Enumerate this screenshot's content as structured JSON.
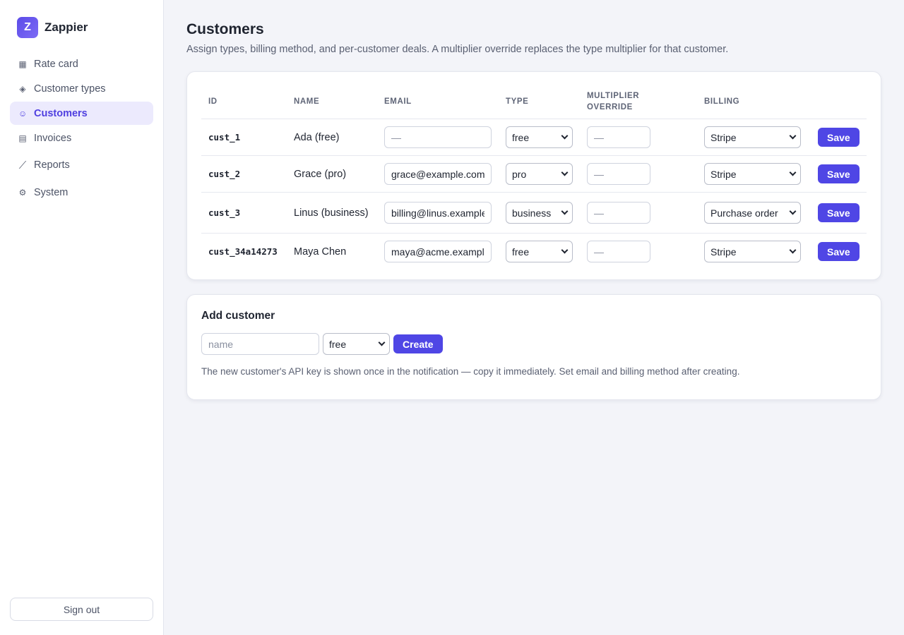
{
  "brand": {
    "logo_letter": "Z",
    "name": "Zappier"
  },
  "sidebar": {
    "items": [
      {
        "label": "Rate card",
        "icon": "grid-icon",
        "glyph": "▦"
      },
      {
        "label": "Customer types",
        "icon": "diamond-icon",
        "glyph": "◈"
      },
      {
        "label": "Customers",
        "icon": "smiley-icon",
        "glyph": "☺",
        "active": true
      },
      {
        "label": "Invoices",
        "icon": "list-icon",
        "glyph": "▤"
      },
      {
        "label": "Reports",
        "icon": "trend-line-icon",
        "glyph": "⟋"
      },
      {
        "label": "System",
        "icon": "gear-icon",
        "glyph": "⚙"
      }
    ],
    "signout_label": "Sign out"
  },
  "page": {
    "title": "Customers",
    "subtitle": "Assign types, billing method, and per-customer deals. A multiplier override replaces the type multiplier for that customer."
  },
  "table": {
    "headers": {
      "id": "ID",
      "name": "NAME",
      "email": "EMAIL",
      "type": "TYPE",
      "multiplier_line1": "MULTIPLIER",
      "multiplier_line2": "OVERRIDE",
      "billing": "BILLING"
    },
    "email_placeholder": "—",
    "multiplier_placeholder": "—",
    "save_label": "Save",
    "rows": [
      {
        "id": "cust_1",
        "name": "Ada (free)",
        "email": "",
        "type": "free",
        "multiplier": "",
        "billing": "Stripe"
      },
      {
        "id": "cust_2",
        "name": "Grace (pro)",
        "email": "grace@example.com",
        "type": "pro",
        "multiplier": "",
        "billing": "Stripe"
      },
      {
        "id": "cust_3",
        "name": "Linus (business)",
        "email": "billing@linus.example",
        "type": "business",
        "multiplier": "",
        "billing": "Purchase order"
      },
      {
        "id": "cust_34a14273",
        "name": "Maya Chen",
        "email": "maya@acme.example",
        "type": "free",
        "multiplier": "",
        "billing": "Stripe"
      }
    ]
  },
  "add_customer": {
    "title": "Add customer",
    "name_placeholder": "name",
    "type_value": "free",
    "create_label": "Create",
    "note": "The new customer's API key is shown once in the notification — copy it immediately. Set email and billing method after creating."
  },
  "colors": {
    "accent": "#4f46e5",
    "active_bg": "#eceafd",
    "background": "#f3f4f9"
  }
}
